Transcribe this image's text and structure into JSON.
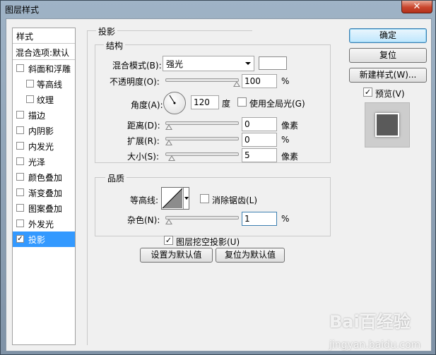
{
  "window": {
    "title": "图层样式",
    "close_glyph": "✕"
  },
  "left_panel": {
    "header": "样式",
    "blend_options": "混合选项:默认",
    "items": [
      {
        "label": "斜面和浮雕",
        "checked": false,
        "sub": false
      },
      {
        "label": "等高线",
        "checked": false,
        "sub": true
      },
      {
        "label": "纹理",
        "checked": false,
        "sub": true
      },
      {
        "label": "描边",
        "checked": false,
        "sub": false
      },
      {
        "label": "内阴影",
        "checked": false,
        "sub": false
      },
      {
        "label": "内发光",
        "checked": false,
        "sub": false
      },
      {
        "label": "光泽",
        "checked": false,
        "sub": false
      },
      {
        "label": "颜色叠加",
        "checked": false,
        "sub": false
      },
      {
        "label": "渐变叠加",
        "checked": false,
        "sub": false
      },
      {
        "label": "图案叠加",
        "checked": false,
        "sub": false
      },
      {
        "label": "外发光",
        "checked": false,
        "sub": false
      },
      {
        "label": "投影",
        "checked": true,
        "sub": false,
        "selected": true
      }
    ]
  },
  "drop_shadow": {
    "title": "投影",
    "structure": {
      "title": "结构",
      "blend_mode_label": "混合模式(B):",
      "blend_mode_value": "强光",
      "opacity_label": "不透明度(O):",
      "opacity_value": "100",
      "opacity_unit": "%",
      "opacity_level": 1.0,
      "angle_label": "角度(A):",
      "angle_value": "120",
      "angle_unit": "度",
      "global_light_label": "使用全局光(G)",
      "global_light_checked": false,
      "distance_label": "距离(D):",
      "distance_value": "0",
      "distance_unit": "像素",
      "spread_label": "扩展(R):",
      "spread_value": "0",
      "spread_unit": "%",
      "size_label": "大小(S):",
      "size_value": "5",
      "size_unit": "像素"
    },
    "quality": {
      "title": "品质",
      "contour_label": "等高线:",
      "antialias_label": "消除锯齿(L)",
      "antialias_checked": false,
      "noise_label": "杂色(N):",
      "noise_value": "1",
      "noise_unit": "%"
    },
    "knockout_label": "图层挖空投影(U)",
    "knockout_checked": true,
    "make_default_label": "设置为默认值",
    "reset_default_label": "复位为默认值"
  },
  "buttons": {
    "ok": "确定",
    "reset": "复位",
    "new_style": "新建样式(W)...",
    "preview_label": "预览(V)",
    "preview_checked": true
  },
  "watermark": {
    "text": "Bai百经验",
    "sub": "jingyan.baidu.com"
  },
  "check_glyph": "✓"
}
